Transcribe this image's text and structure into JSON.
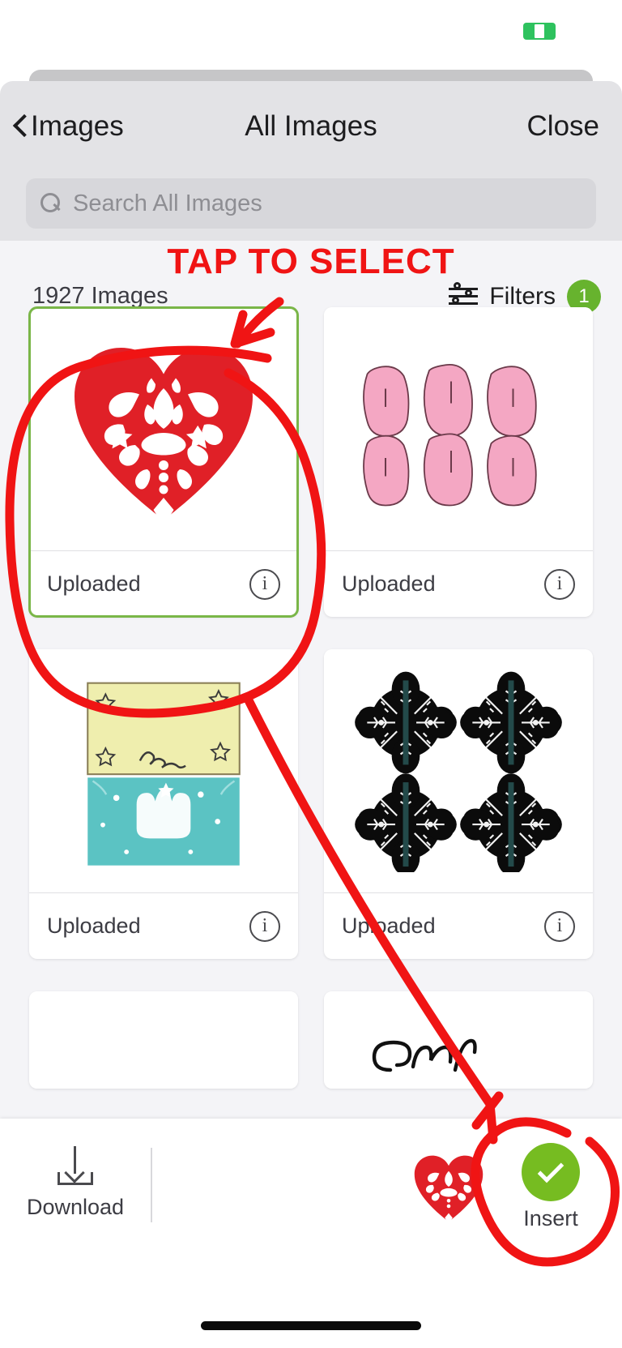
{
  "statusbar": {
    "battery_icon": "battery-charging-icon",
    "battery_color": "#2ec25e"
  },
  "header": {
    "back_label": "Images",
    "back_icon": "chevron-left-icon",
    "title": "All Images",
    "close_label": "Close"
  },
  "search": {
    "placeholder": "Search All Images",
    "value": "",
    "icon": "search-icon"
  },
  "toolbar_top": {
    "count_label": "1927 Images",
    "filters_label": "Filters",
    "filters_icon": "sliders-icon",
    "filters_badge": "1",
    "badge_color": "#67b32e"
  },
  "grid": {
    "cards": [
      {
        "artwork": "decorative-heart",
        "label": "Uploaded",
        "info_icon": "info-icon",
        "selected": true
      },
      {
        "artwork": "pink-apples",
        "label": "Uploaded",
        "info_icon": "info-icon",
        "selected": false
      },
      {
        "artwork": "cards-set",
        "label": "Uploaded",
        "info_icon": "info-icon",
        "selected": false
      },
      {
        "artwork": "black-rosettes",
        "label": "Uploaded",
        "info_icon": "info-icon",
        "selected": false
      },
      {
        "artwork": "blank",
        "label": "",
        "info_icon": "",
        "selected": false
      },
      {
        "artwork": "script-signature",
        "label": "",
        "info_icon": "",
        "selected": false
      }
    ]
  },
  "bottom_bar": {
    "download_label": "Download",
    "download_icon": "download-icon",
    "selected_thumb": "decorative-heart-thumb",
    "insert_label": "Insert",
    "insert_icon": "check-circle-icon",
    "insert_color": "#76bc21"
  },
  "annotation": {
    "text": "TAP TO SELECT",
    "color": "#f01414",
    "shapes": [
      "arrow-to-first-card",
      "circle-around-first-card",
      "arrow-to-insert",
      "circle-around-insert"
    ]
  }
}
